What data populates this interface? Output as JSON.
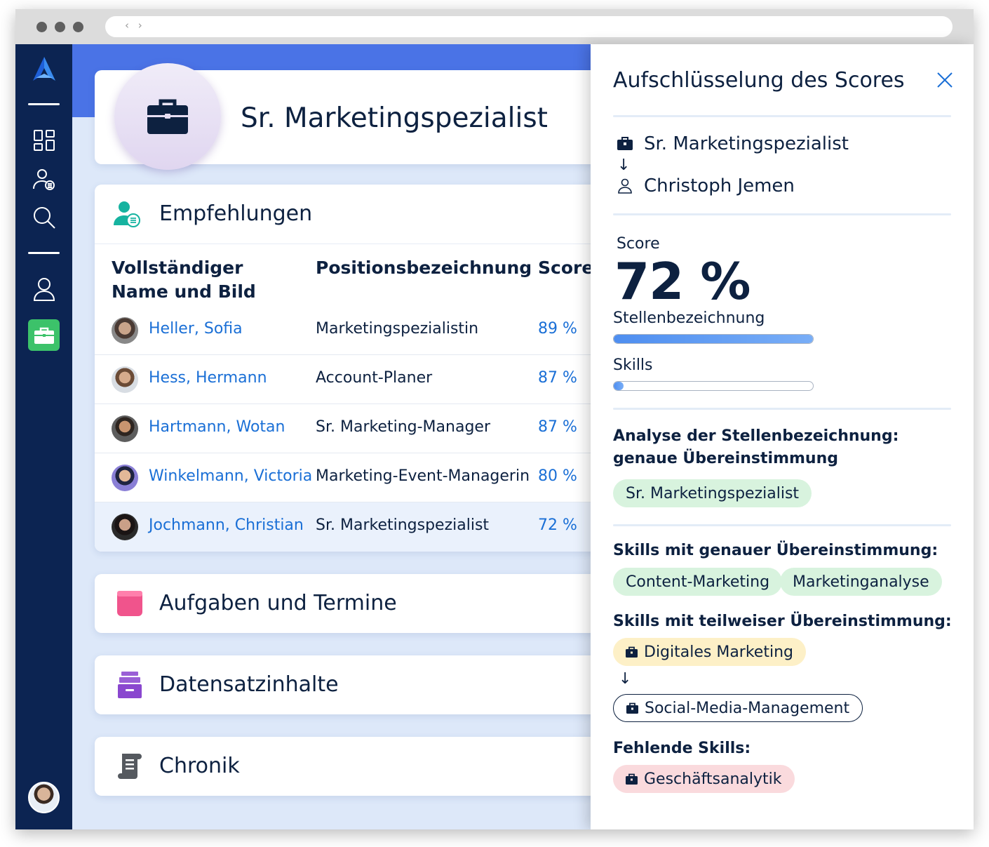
{
  "window": {
    "url_nav": "‹ ›"
  },
  "main": {
    "job_title": "Sr. Marketingspezialist",
    "recommendations": {
      "title": "Empfehlungen",
      "columns": {
        "name": "Vollständiger Name und Bild",
        "position": "Positionsbezeichnung",
        "score": "Score"
      },
      "rows": [
        {
          "name": "Heller, Sofia",
          "position": "Marketingspezialistin",
          "score": "89 %"
        },
        {
          "name": "Hess, Hermann",
          "position": "Account-Planer",
          "score": "87 %"
        },
        {
          "name": "Hartmann, Wotan",
          "position": "Sr. Marketing-Manager",
          "score": "87 %"
        },
        {
          "name": "Winkelmann, Victoria",
          "position": "Marketing-Event-Managerin",
          "score": "80 %"
        },
        {
          "name": "Jochmann, Christian",
          "position": "Sr. Marketingspezialist",
          "score": "72 %"
        }
      ]
    },
    "sections": {
      "tasks": "Aufgaben und Termine",
      "records": "Datensatzinhalte",
      "chronicle": "Chronik"
    }
  },
  "panel": {
    "title": "Aufschlüsselung des Scores",
    "job": "Sr. Marketingspezialist",
    "candidate": "Christoph Jemen",
    "arrow": "↓",
    "score_label": "Score",
    "score_value": "72 %",
    "bars": {
      "title_label": "Stellenbezeichnung",
      "title_fraction": 1.0,
      "skills_label": "Skills",
      "skills_fraction": 0.05
    },
    "title_analysis": {
      "heading": "Analyse der Stellenbezeichnung: genaue Übereinstimmung",
      "chip": "Sr. Marketingspezialist"
    },
    "exact_skills": {
      "heading": "Skills mit genauer Übereinstimmung:",
      "chips": [
        "Content-Marketing",
        "Marketinganalyse"
      ]
    },
    "partial_skills": {
      "heading": "Skills mit teilweiser Übereinstimmung:",
      "from": "Digitales Marketing",
      "to": "Social-Media-Management"
    },
    "missing_skills": {
      "heading": "Fehlende Skills:",
      "chip": "Geschäftsanalytik"
    }
  },
  "colors": {
    "sidebar": "#0c2452",
    "banner": "#4a73e6",
    "active_nav": "#3cc26a",
    "link": "#1a6fd6",
    "chip_green": "#d8f3de",
    "chip_yellow": "#fdf0c7",
    "chip_red": "#fadadd"
  }
}
